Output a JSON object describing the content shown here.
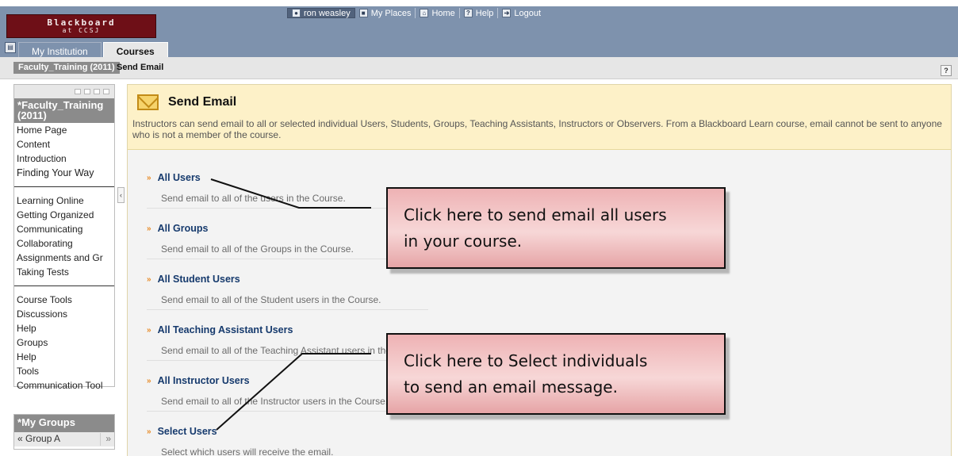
{
  "header": {
    "logo_main": "Blackboard",
    "logo_sub": "at CCSJ",
    "utility": {
      "user": "ron weasley",
      "my_places": "My Places",
      "home": "Home",
      "help": "Help",
      "logout": "Logout"
    },
    "tabs": [
      {
        "label": "My Institution"
      },
      {
        "label": "Courses"
      }
    ]
  },
  "breadcrumb": {
    "course": "Faculty_Training (2011)",
    "page": "Send Email",
    "help_glyph": "?"
  },
  "sidebar": {
    "course_title": "Faculty_Training (2011)",
    "section1": [
      "Home Page",
      "Content",
      "Introduction",
      "Finding Your Way"
    ],
    "section2": [
      "Learning Online",
      "Getting Organized",
      "Communicating",
      "Collaborating",
      "Assignments and Gr",
      "Taking Tests"
    ],
    "section3": [
      "Course Tools",
      "Discussions",
      "Help",
      "Groups",
      "Help",
      "Tools",
      "Communication Tool"
    ],
    "groups_title": "My Groups",
    "group_item": "Group A"
  },
  "main": {
    "title": "Send Email",
    "description": "Instructors can send email to all or selected individual Users, Students, Groups, Teaching Assistants, Instructors or Observers. From a Blackboard Learn course, email cannot be sent to anyone who is not a member of the course.",
    "options": [
      {
        "title": "All Users",
        "desc": "Send email to all of the users in the Course."
      },
      {
        "title": "All Groups",
        "desc": "Send email to all of the Groups in the Course."
      },
      {
        "title": "All Student Users",
        "desc": "Send email to all of the Student users in the Course."
      },
      {
        "title": "All Teaching Assistant Users",
        "desc": "Send email to all of the Teaching Assistant users in the Course."
      },
      {
        "title": "All Instructor Users",
        "desc": "Send email to all of the Instructor users in the Course."
      },
      {
        "title": "Select Users",
        "desc": "Select which users will receive the email."
      }
    ]
  },
  "callouts": [
    {
      "line1": "Click here to send email all users",
      "line2": "in your course."
    },
    {
      "line1": "Click here to Select individuals",
      "line2": "to send an email message."
    }
  ],
  "colors": {
    "header": "#7e92ad",
    "logo": "#6e0f17",
    "link": "#163a6d",
    "info_bg": "#fdf1c8",
    "callout": "#eeb2b4"
  }
}
